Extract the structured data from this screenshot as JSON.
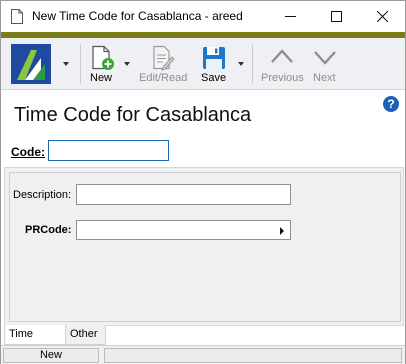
{
  "window": {
    "title": "New Time Code for Casablanca - areed",
    "accent_color": "#7c7c18"
  },
  "toolbar": {
    "new_label": "New",
    "edit_read_label": "Edit/Read",
    "save_label": "Save",
    "previous_label": "Previous",
    "next_label": "Next",
    "logo_icon": "app-logo-icon"
  },
  "header": {
    "title": "Time Code for Casablanca",
    "help_glyph": "?"
  },
  "form": {
    "code_label": "Code:",
    "code_value": "",
    "description_label": "Description:",
    "description_value": "",
    "prcode_label": "PRCode:",
    "prcode_value": ""
  },
  "tabs": [
    "Time Code",
    "Other"
  ],
  "status": {
    "mode": "New",
    "message": ""
  }
}
